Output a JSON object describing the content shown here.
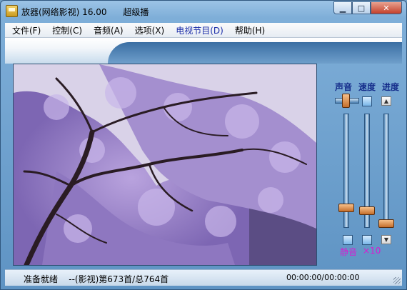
{
  "window": {
    "title": "放器(网络影视) 16.00      超级播",
    "minimize_glyph": "▁",
    "maximize_glyph": "□",
    "close_glyph": "✕"
  },
  "menu": [
    {
      "label": "文件(F)"
    },
    {
      "label": "控制(C)"
    },
    {
      "label": "音频(A)"
    },
    {
      "label": "选项(X)"
    },
    {
      "label": "电视节目(D)",
      "highlighted": true
    },
    {
      "label": "帮助(H)"
    }
  ],
  "controls": {
    "volume_label": "声音",
    "speed_label": "速度",
    "progress_label": "进度",
    "mute_label": "静音",
    "speed_multiplier": "×10",
    "up_glyph": "▲",
    "down_glyph": "▼",
    "volume_level": 0.15,
    "speed_level": 0.12,
    "progress_level": 0.0
  },
  "status": {
    "text": "准备就绪    --(影视)第673首/总764首",
    "time": "00:00:00/00:00:00"
  },
  "colors": {
    "accent": "#142c8a",
    "magenta": "#d41fd0",
    "menu_highlight": "#1a2ca8"
  },
  "icons": [
    "app-icon",
    "minimize-icon",
    "maximize-icon",
    "close-icon",
    "up-arrow-icon",
    "down-arrow-icon",
    "resize-grip-icon"
  ]
}
